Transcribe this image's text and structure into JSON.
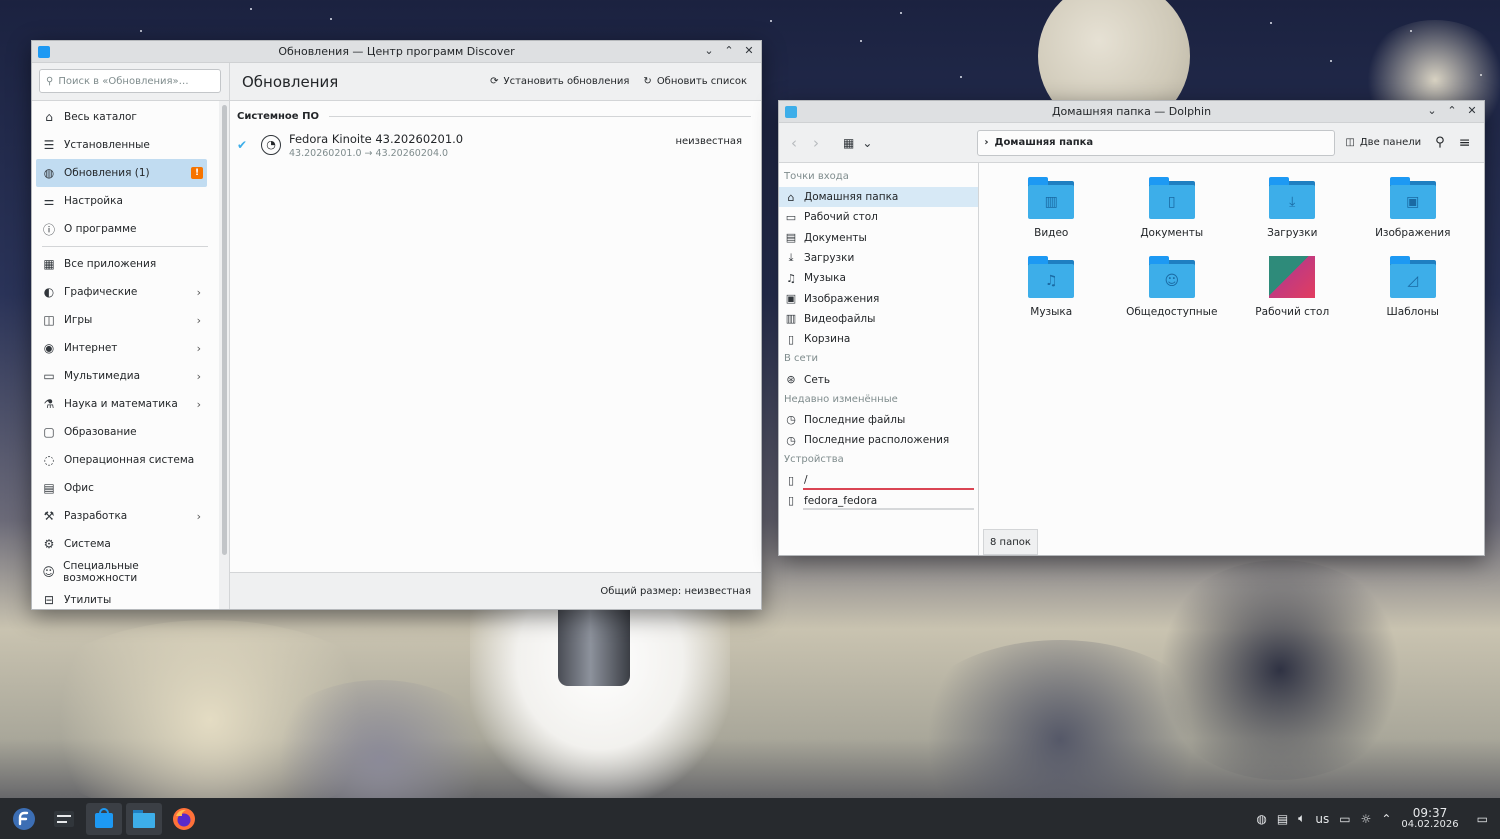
{
  "discover": {
    "title": "Обновления — Центр программ Discover",
    "search_placeholder": "Поиск в «Обновления»…",
    "page_title": "Обновления",
    "install_label": "Установить обновления",
    "refresh_label": "Обновить список",
    "sidebar": [
      {
        "label": "Весь каталог",
        "icon": "house-icon"
      },
      {
        "label": "Установленные",
        "icon": "list-icon"
      },
      {
        "label": "Обновления (1)",
        "icon": "update-icon",
        "badge": "!"
      },
      {
        "label": "Настройка",
        "icon": "sliders-icon"
      },
      {
        "label": "О программе",
        "icon": "info-icon"
      },
      {
        "label": "Все приложения",
        "icon": "grid-icon"
      },
      {
        "label": "Графические",
        "icon": "palette-icon"
      },
      {
        "label": "Игры",
        "icon": "gamepad-icon"
      },
      {
        "label": "Интернет",
        "icon": "globe-icon"
      },
      {
        "label": "Мультимедиа",
        "icon": "monitor-icon"
      },
      {
        "label": "Наука и математика",
        "icon": "flask-icon"
      },
      {
        "label": "Образование",
        "icon": "board-icon"
      },
      {
        "label": "Операционная система",
        "icon": "os-icon"
      },
      {
        "label": "Офис",
        "icon": "document-icon"
      },
      {
        "label": "Разработка",
        "icon": "hammer-icon"
      },
      {
        "label": "Система",
        "icon": "cog-icon"
      },
      {
        "label": "Специальные возможности",
        "icon": "accessibility-icon"
      },
      {
        "label": "Утилиты",
        "icon": "toolbox-icon"
      }
    ],
    "section_title": "Системное ПО",
    "update": {
      "name": "Fedora Kinoite 43.20260201.0",
      "version": "43.20260201.0 → 43.20260204.0",
      "size": "неизвестная"
    },
    "footer": "Общий размер: неизвестная"
  },
  "dolphin": {
    "title": "Домашняя папка — Dolphin",
    "breadcrumb": "Домашняя папка",
    "split_label": "Две панели",
    "places_sections": {
      "entry": "Точки входа",
      "network": "В сети",
      "recent": "Недавно изменённые",
      "devices": "Устройства"
    },
    "places_entry": [
      "Домашняя папка",
      "Рабочий стол",
      "Документы",
      "Загрузки",
      "Музыка",
      "Изображения",
      "Видеофайлы",
      "Корзина"
    ],
    "places_network": [
      "Сеть"
    ],
    "places_recent": [
      "Последние файлы",
      "Последние расположения"
    ],
    "places_devices": [
      "/",
      "fedora_fedora"
    ],
    "folders": [
      "Видео",
      "Документы",
      "Загрузки",
      "Изображения",
      "Музыка",
      "Общедоступные",
      "Рабочий стол",
      "Шаблоны"
    ],
    "status": "8 папок"
  },
  "taskbar": {
    "keyboard_layout": "us",
    "time": "09:37",
    "date": "04.02.2026"
  }
}
